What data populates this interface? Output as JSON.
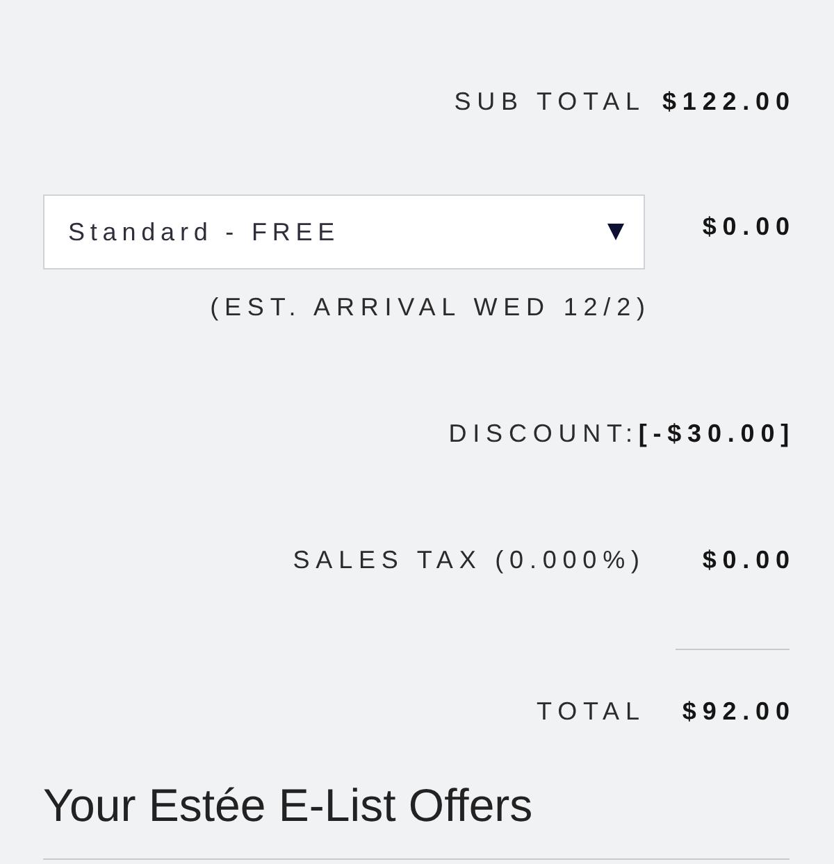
{
  "summary": {
    "rows": [
      {
        "kind": "amount",
        "label": "SUB TOTAL",
        "value": "$122.00"
      },
      {
        "kind": "shipping",
        "selected_option": "Standard - FREE",
        "value": "$0.00",
        "note": "(EST. ARRIVAL WED 12/2)"
      },
      {
        "kind": "inline",
        "label": "DISCOUNT:",
        "value": "[-$30.00]"
      },
      {
        "kind": "amount",
        "label": "SALES TAX (0.000%)",
        "value": "$0.00"
      },
      {
        "kind": "total",
        "label": "TOTAL",
        "value": "$92.00"
      }
    ]
  },
  "offers": {
    "title": "Your Estée E-List Offers"
  }
}
